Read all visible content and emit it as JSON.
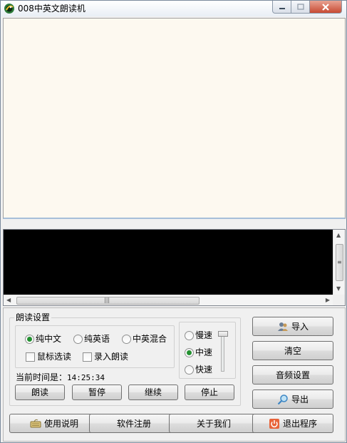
{
  "window": {
    "title": "008中英文朗读机"
  },
  "read_settings": {
    "legend": "朗读设置",
    "language_options": [
      {
        "label": "纯中文",
        "selected": true
      },
      {
        "label": "纯英语",
        "selected": false
      },
      {
        "label": "中英混合",
        "selected": false
      }
    ],
    "checkboxes": [
      {
        "label": "鼠标选读",
        "checked": false
      },
      {
        "label": "录入朗读",
        "checked": false
      }
    ],
    "speed_options": [
      {
        "label": "慢速",
        "selected": false
      },
      {
        "label": "中速",
        "selected": true
      },
      {
        "label": "快速",
        "selected": false
      }
    ],
    "time_label": "当前时间是：",
    "time_value": "14:25:34",
    "buttons": {
      "read": "朗读",
      "pause": "暂停",
      "resume": "继续",
      "stop": "停止"
    }
  },
  "side_buttons": {
    "import": "导入",
    "clear": "清空",
    "audio_settings": "音频设置",
    "export": "导出"
  },
  "bottom_buttons": {
    "manual": "使用说明",
    "register": "软件注册",
    "about": "关于我们",
    "exit": "退出程序"
  },
  "icons": {
    "app": "parrot-icon",
    "import": "people-icon",
    "export": "magnifier-icon",
    "manual": "keyboard-icon",
    "exit": "power-icon"
  },
  "colors": {
    "radio_selected": "#239131",
    "text_area_bg": "#fdf9f0",
    "second_area_bg": "#000000",
    "close_button": "#c84a32"
  }
}
